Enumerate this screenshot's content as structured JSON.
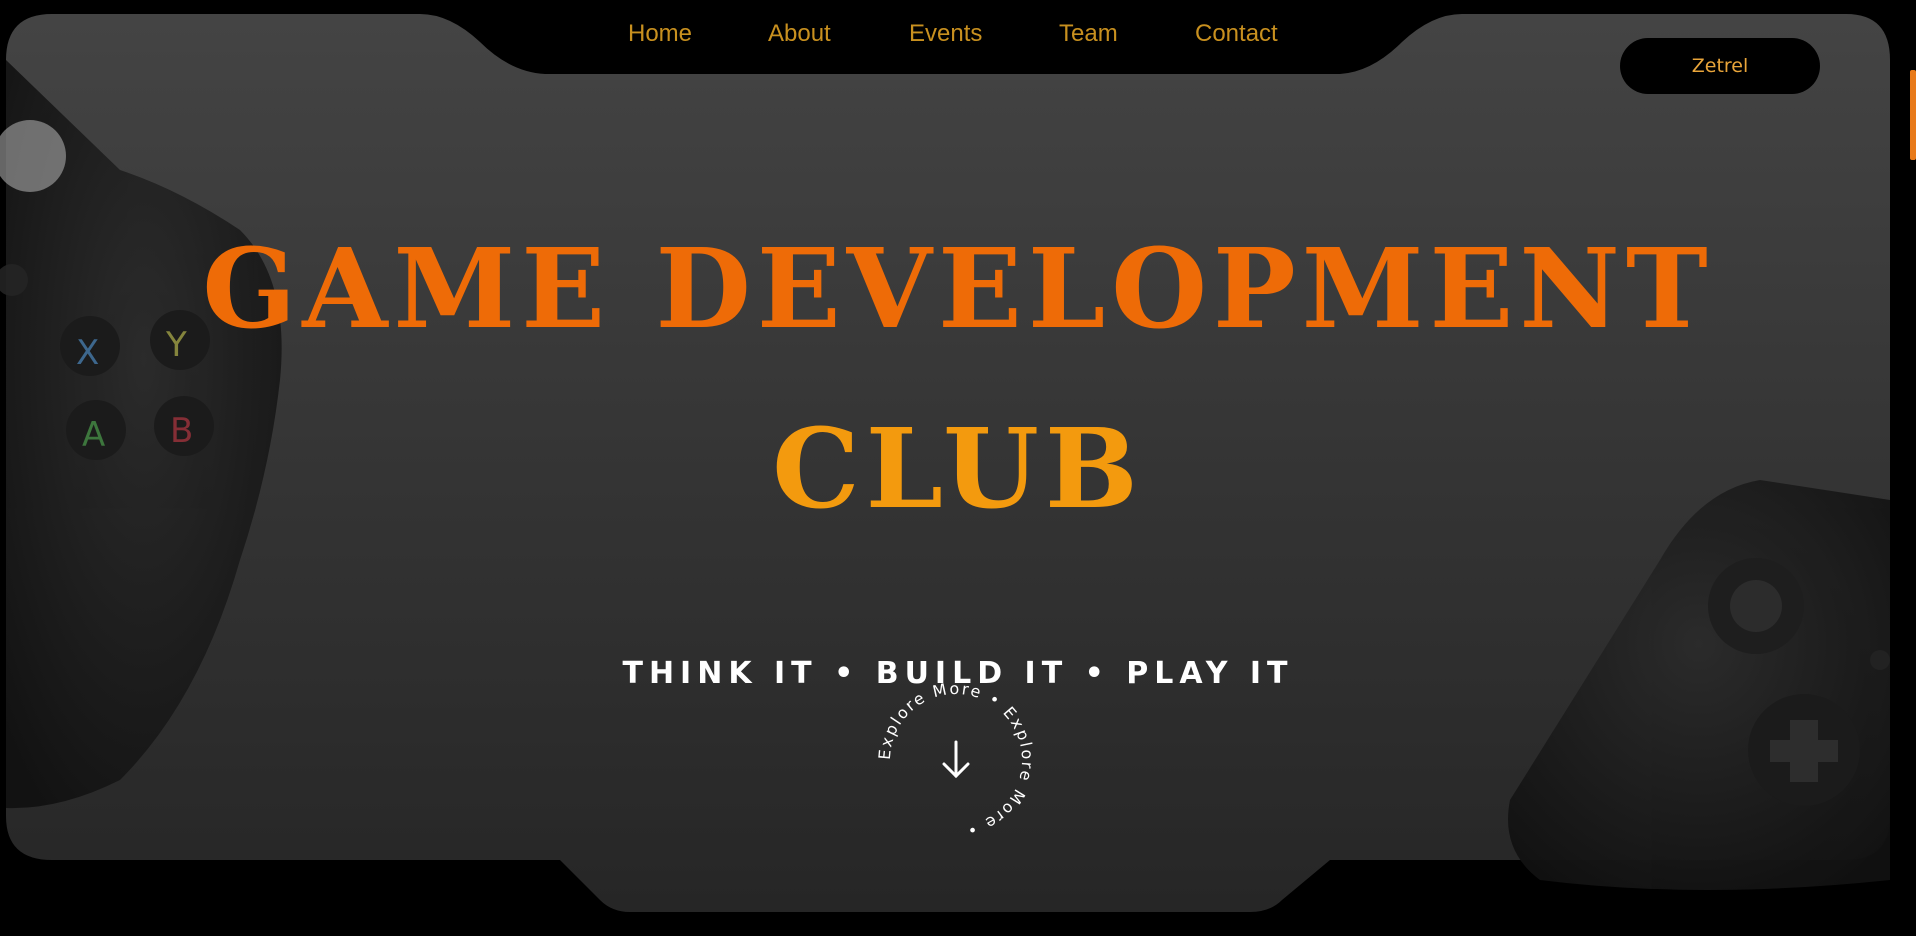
{
  "nav": {
    "items": [
      {
        "label": "Home"
      },
      {
        "label": "About"
      },
      {
        "label": "Events"
      },
      {
        "label": "Team"
      },
      {
        "label": "Contact"
      }
    ]
  },
  "brand_button": {
    "label": "Zetrel"
  },
  "hero": {
    "title_line1": "GAME DEVELOPMENT",
    "title_line2": "CLUB",
    "tagline": "THINK IT • BUILD IT • PLAY IT"
  },
  "explore": {
    "ring_text": "Explore More • Explore More • ",
    "icon": "arrow-down-icon"
  },
  "colors": {
    "nav_text": "#c8901f",
    "title_primary": "#ee6b07",
    "title_secondary": "#f39a0e",
    "accent": "#e87a1a",
    "brand_text": "#e9a53a"
  },
  "decorations": {
    "left_image": "game-controller-left",
    "right_image": "game-controller-right"
  }
}
